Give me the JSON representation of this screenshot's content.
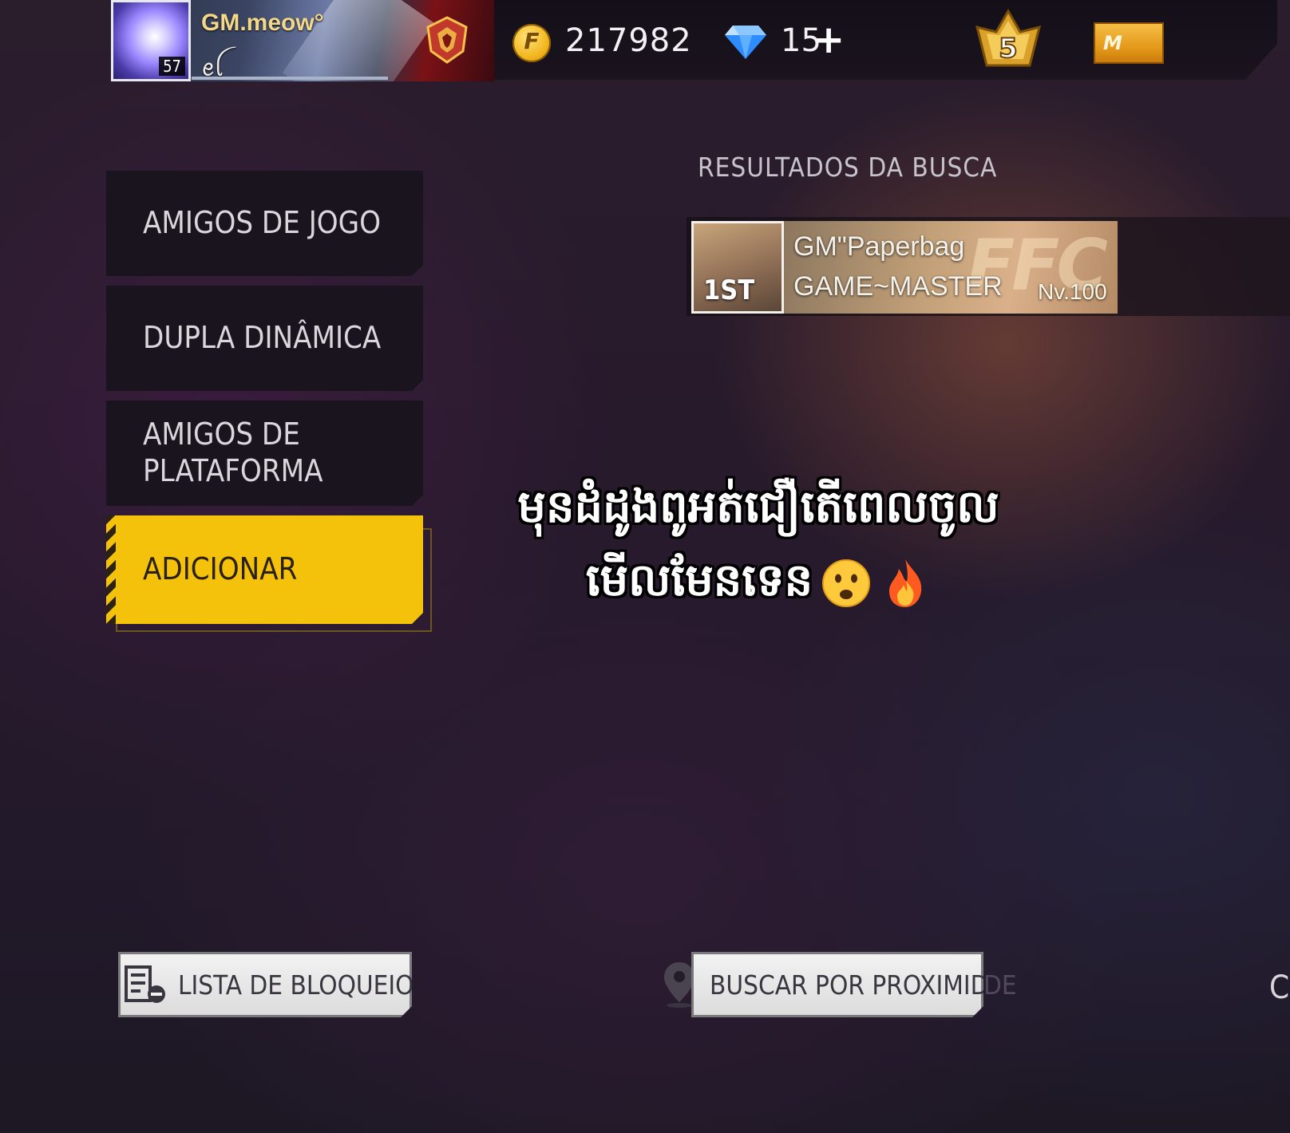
{
  "player": {
    "name": "GM.meow°",
    "tag": "ꫀꪶ",
    "level": "57"
  },
  "currency": {
    "gold_icon": "gold-coin-icon",
    "gold": "217982",
    "diamond_icon": "diamond-icon",
    "diamonds": "15",
    "diamond_plus": "+"
  },
  "rank": {
    "icon": "rank-crown-icon",
    "value": "5"
  },
  "membership": {
    "icon": "membership-icon",
    "label": "M"
  },
  "menu": {
    "items": [
      {
        "label": "AMIGOS DE JOGO",
        "active": false
      },
      {
        "label": "DUPLA DINÂMICA",
        "active": false
      },
      {
        "label": "AMIGOS DE\nPLATAFORMA",
        "active": false
      },
      {
        "label": "ADICIONAR",
        "active": true
      }
    ],
    "active_color": "#f5c20b"
  },
  "search": {
    "title": "RESULTADOS DA BUSCA",
    "results": [
      {
        "avatar_text": "1ST",
        "name": "GM\"Paperbag",
        "tag": "GAME~MASTER",
        "banner_text": "FFC",
        "level": "Nv.100"
      }
    ]
  },
  "caption": {
    "line1": "មុនដំដូងពូអត់ជឿតើពេលចូល",
    "line2": "មើលមែនទេន",
    "emojis": [
      "worried-face-icon",
      "fire-icon"
    ]
  },
  "buttons": {
    "block_list": "LISTA DE BLOQUEIOS",
    "nearby_visible": "BUSCAR POR PROXIMIDA",
    "nearby_overflow": "DE",
    "edge_text": "C"
  }
}
